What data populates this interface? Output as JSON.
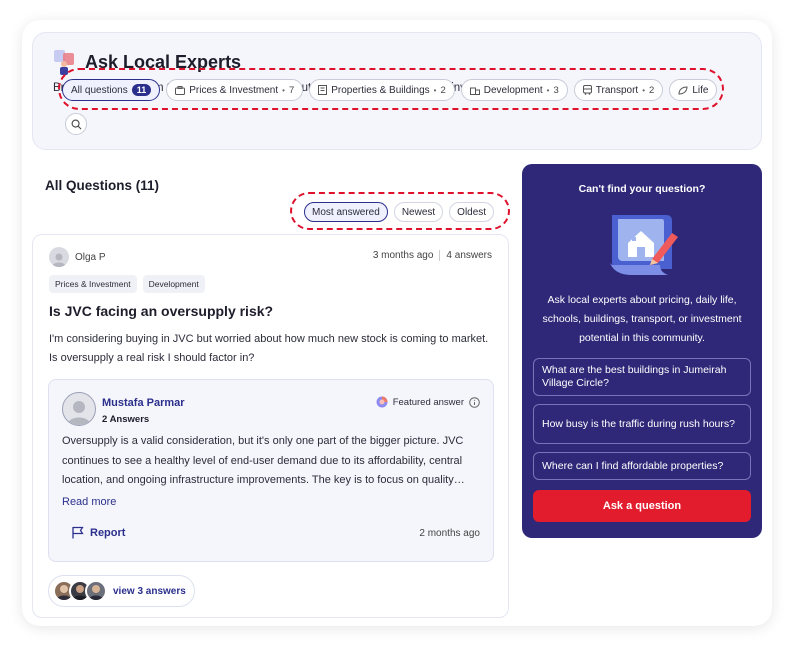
{
  "hero": {
    "title": "Ask Local Experts",
    "subtitle": "Browse answers from top community agents about living, buying, renting, and investing in this area."
  },
  "categories": [
    {
      "label": "All questions",
      "count": "11",
      "active": true,
      "icon": ""
    },
    {
      "label": "Prices & Investment",
      "count": "7",
      "icon": "briefcase-icon"
    },
    {
      "label": "Properties & Buildings",
      "count": "2",
      "icon": "building-icon"
    },
    {
      "label": "Development",
      "count": "3",
      "icon": "crane-icon"
    },
    {
      "label": "Transport",
      "count": "2",
      "icon": "bus-icon"
    },
    {
      "label": "Life",
      "count": "",
      "icon": "leaf-icon"
    }
  ],
  "list": {
    "title": "All Questions (11)",
    "sort": [
      "Most answered",
      "Newest",
      "Oldest"
    ]
  },
  "question": {
    "author": "Olga P",
    "time": "3 months ago",
    "answers": "4 answers",
    "tags": [
      "Prices & Investment",
      "Development"
    ],
    "title": "Is JVC facing an oversupply risk?",
    "body": "I'm considering buying in JVC but worried about how much new stock is coming to market. Is oversupply a real risk I should factor in?"
  },
  "answer": {
    "name": "Mustafa Parmar",
    "count": "2 Answers",
    "featured": "Featured answer",
    "body": "Oversupply is a valid consideration, but it's only one part of the bigger picture. JVC continues to see a healthy level of end-user demand due to its affordability, central location, and ongoing infrastructure improvements. The key is to focus on quality…",
    "read_more": "Read more",
    "report": "Report",
    "time": "2 months ago"
  },
  "view_answers": "view 3 answers",
  "cta": {
    "title": "Can't find your question?",
    "desc": "Ask local experts about pricing, daily life, schools, buildings, transport, or investment potential in this community.",
    "suggestions": [
      "What are the best buildings in Jumeirah Village Circle?",
      "How busy is the traffic during rush hours?",
      "Where can I find affordable properties?"
    ],
    "button": "Ask a question"
  },
  "colors": {
    "brand": "#2b2f8c",
    "cta_bg": "#2f2878",
    "accent_red": "#e21b2d",
    "highlight_dash": "#e0112c"
  }
}
